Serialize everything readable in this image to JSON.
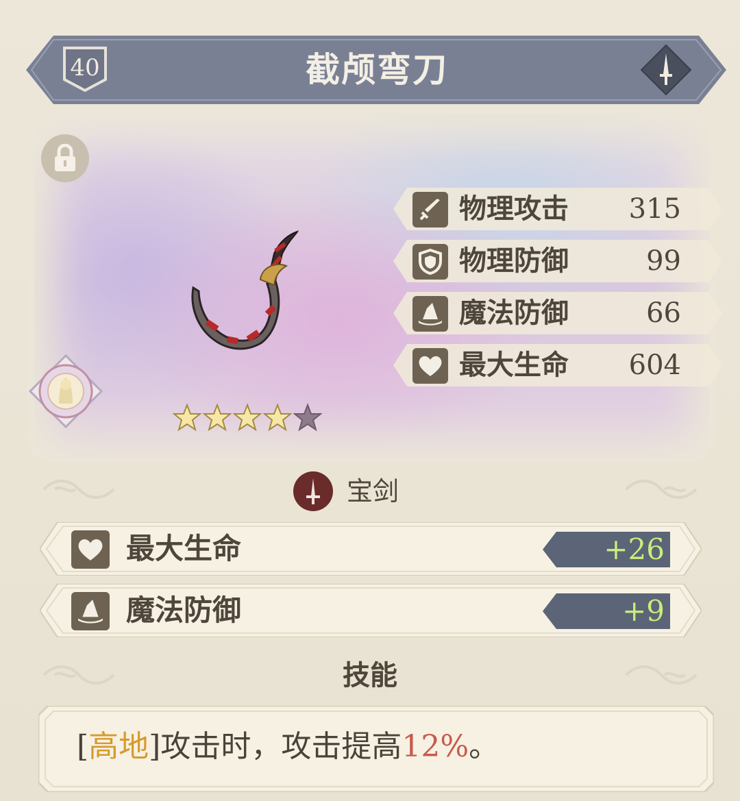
{
  "item": {
    "level": "40",
    "name": "截颅弯刀",
    "type_icon": "sword-icon",
    "rarity_stars": 4,
    "rarity_max": 5
  },
  "stats": [
    {
      "icon": "sword-icon",
      "label": "物理攻击",
      "value": "315"
    },
    {
      "icon": "shield-icon",
      "label": "物理防御",
      "value": "99"
    },
    {
      "icon": "wizard-hat-icon",
      "label": "魔法防御",
      "value": "66"
    },
    {
      "icon": "heart-icon",
      "label": "最大生命",
      "value": "604"
    }
  ],
  "category": {
    "icon": "sword-icon",
    "label": "宝剑"
  },
  "bonuses": [
    {
      "icon": "heart-icon",
      "label": "最大生命",
      "value": "+26"
    },
    {
      "icon": "wizard-hat-icon",
      "label": "魔法防御",
      "value": "+9"
    }
  ],
  "skills": {
    "title": "技能",
    "text_open": "[",
    "keyword": "高地",
    "text_mid": "]攻击时，攻击提高",
    "percent": "12%",
    "text_end": "。"
  },
  "colors": {
    "banner": "#7a8094",
    "icon_box": "#6e6352",
    "bonus_pill": "#5c6478",
    "bonus_value": "#c9ee7a",
    "keyword": "#d79a2e",
    "percent": "#c95a4e"
  }
}
